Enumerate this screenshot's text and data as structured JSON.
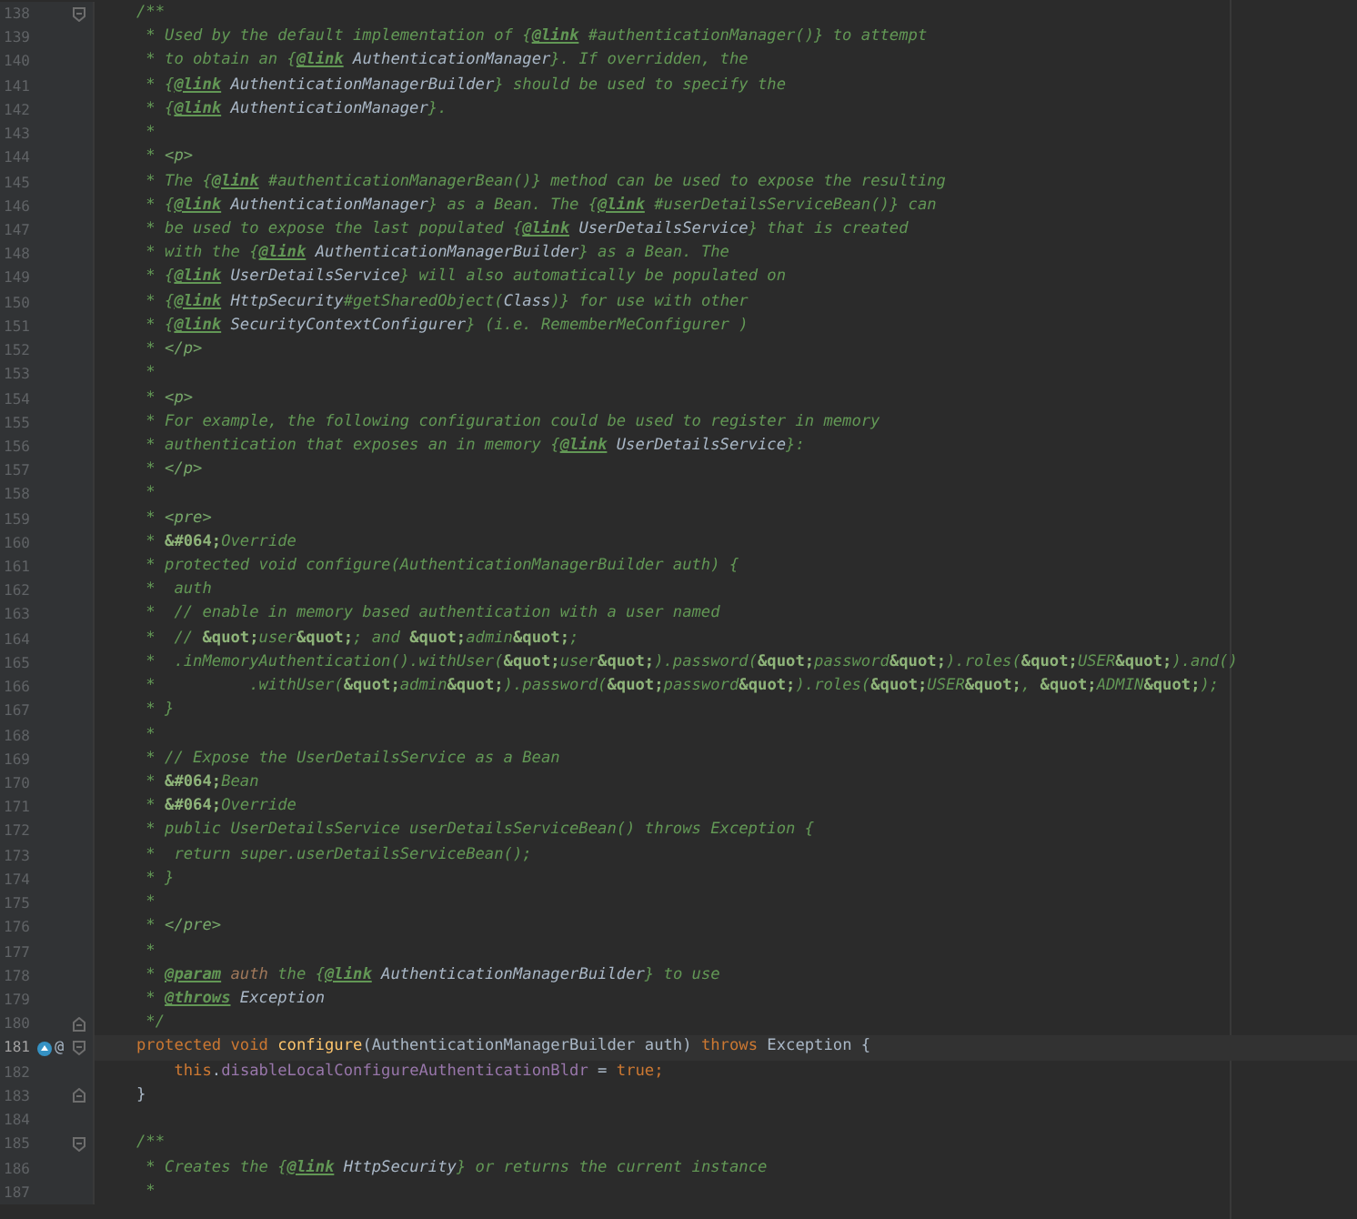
{
  "editor": {
    "lines": [
      {
        "number": "138",
        "current": false,
        "fold_start": true,
        "segments": [
          {
            "kind": "comment",
            "text": "/**"
          }
        ]
      },
      {
        "number": "139",
        "current": false,
        "segments": [
          {
            "kind": "comment",
            "text": " * Used by the default implementation of {"
          },
          {
            "kind": "tag",
            "text": "@link"
          },
          {
            "kind": "comment",
            "text": " #authenticationManager()} to attempt"
          }
        ]
      },
      {
        "number": "140",
        "current": false,
        "segments": [
          {
            "kind": "comment",
            "text": " * to obtain an {"
          },
          {
            "kind": "tag",
            "text": "@link"
          },
          {
            "kind": "ref",
            "text": " AuthenticationManager"
          },
          {
            "kind": "comment",
            "text": "}. If overridden, the"
          }
        ]
      },
      {
        "number": "141",
        "current": false,
        "segments": [
          {
            "kind": "comment",
            "text": " * {"
          },
          {
            "kind": "tag",
            "text": "@link"
          },
          {
            "kind": "ref",
            "text": " AuthenticationManagerBuilder"
          },
          {
            "kind": "comment",
            "text": "} should be used to specify the"
          }
        ]
      },
      {
        "number": "142",
        "current": false,
        "segments": [
          {
            "kind": "comment",
            "text": " * {"
          },
          {
            "kind": "tag",
            "text": "@link"
          },
          {
            "kind": "ref",
            "text": " AuthenticationManager"
          },
          {
            "kind": "comment",
            "text": "}."
          }
        ]
      },
      {
        "number": "143",
        "current": false,
        "segments": [
          {
            "kind": "comment",
            "text": " *"
          }
        ]
      },
      {
        "number": "144",
        "current": false,
        "segments": [
          {
            "kind": "comment",
            "text": " * "
          },
          {
            "kind": "html",
            "text": "<p>"
          }
        ]
      },
      {
        "number": "145",
        "current": false,
        "segments": [
          {
            "kind": "comment",
            "text": " * The {"
          },
          {
            "kind": "tag",
            "text": "@link"
          },
          {
            "kind": "comment",
            "text": " #authenticationManagerBean()} method can be used to expose the resulting"
          }
        ]
      },
      {
        "number": "146",
        "current": false,
        "segments": [
          {
            "kind": "comment",
            "text": " * {"
          },
          {
            "kind": "tag",
            "text": "@link"
          },
          {
            "kind": "ref",
            "text": " AuthenticationManager"
          },
          {
            "kind": "comment",
            "text": "} as a Bean. The {"
          },
          {
            "kind": "tag",
            "text": "@link"
          },
          {
            "kind": "comment",
            "text": " #userDetailsServiceBean()} can"
          }
        ]
      },
      {
        "number": "147",
        "current": false,
        "segments": [
          {
            "kind": "comment",
            "text": " * be used to expose the last populated {"
          },
          {
            "kind": "tag",
            "text": "@link"
          },
          {
            "kind": "ref",
            "text": " UserDetailsService"
          },
          {
            "kind": "comment",
            "text": "} that is created"
          }
        ]
      },
      {
        "number": "148",
        "current": false,
        "segments": [
          {
            "kind": "comment",
            "text": " * with the {"
          },
          {
            "kind": "tag",
            "text": "@link"
          },
          {
            "kind": "ref",
            "text": " AuthenticationManagerBuilder"
          },
          {
            "kind": "comment",
            "text": "} as a Bean. The"
          }
        ]
      },
      {
        "number": "149",
        "current": false,
        "segments": [
          {
            "kind": "comment",
            "text": " * {"
          },
          {
            "kind": "tag",
            "text": "@link"
          },
          {
            "kind": "ref",
            "text": " UserDetailsService"
          },
          {
            "kind": "comment",
            "text": "} will also automatically be populated on"
          }
        ]
      },
      {
        "number": "150",
        "current": false,
        "segments": [
          {
            "kind": "comment",
            "text": " * {"
          },
          {
            "kind": "tag",
            "text": "@link"
          },
          {
            "kind": "ref",
            "text": " HttpSecurity"
          },
          {
            "kind": "comment",
            "text": "#getSharedObject("
          },
          {
            "kind": "ref",
            "text": "Class"
          },
          {
            "kind": "comment",
            "text": ")} for use with other"
          }
        ]
      },
      {
        "number": "151",
        "current": false,
        "segments": [
          {
            "kind": "comment",
            "text": " * {"
          },
          {
            "kind": "tag",
            "text": "@link"
          },
          {
            "kind": "ref",
            "text": " SecurityContextConfigurer"
          },
          {
            "kind": "comment",
            "text": "} (i.e. RememberMeConfigurer )"
          }
        ]
      },
      {
        "number": "152",
        "current": false,
        "segments": [
          {
            "kind": "comment",
            "text": " * "
          },
          {
            "kind": "html",
            "text": "</p>"
          }
        ]
      },
      {
        "number": "153",
        "current": false,
        "segments": [
          {
            "kind": "comment",
            "text": " *"
          }
        ]
      },
      {
        "number": "154",
        "current": false,
        "segments": [
          {
            "kind": "comment",
            "text": " * "
          },
          {
            "kind": "html",
            "text": "<p>"
          }
        ]
      },
      {
        "number": "155",
        "current": false,
        "segments": [
          {
            "kind": "comment",
            "text": " * For example, the following configuration could be used to register in memory"
          }
        ]
      },
      {
        "number": "156",
        "current": false,
        "segments": [
          {
            "kind": "comment",
            "text": " * authentication that exposes an in memory {"
          },
          {
            "kind": "tag",
            "text": "@link"
          },
          {
            "kind": "ref",
            "text": " UserDetailsService"
          },
          {
            "kind": "comment",
            "text": "}:"
          }
        ]
      },
      {
        "number": "157",
        "current": false,
        "segments": [
          {
            "kind": "comment",
            "text": " * "
          },
          {
            "kind": "html",
            "text": "</p>"
          }
        ]
      },
      {
        "number": "158",
        "current": false,
        "segments": [
          {
            "kind": "comment",
            "text": " *"
          }
        ]
      },
      {
        "number": "159",
        "current": false,
        "segments": [
          {
            "kind": "comment",
            "text": " * "
          },
          {
            "kind": "html",
            "text": "<pre>"
          }
        ]
      },
      {
        "number": "160",
        "current": false,
        "segments": [
          {
            "kind": "comment",
            "text": " * "
          },
          {
            "kind": "entity",
            "text": "&#064;"
          },
          {
            "kind": "comment",
            "text": "Override"
          }
        ]
      },
      {
        "number": "161",
        "current": false,
        "segments": [
          {
            "kind": "comment",
            "text": " * protected void configure(AuthenticationManagerBuilder auth) {"
          }
        ]
      },
      {
        "number": "162",
        "current": false,
        "segments": [
          {
            "kind": "comment",
            "text": " *  auth"
          }
        ]
      },
      {
        "number": "163",
        "current": false,
        "segments": [
          {
            "kind": "comment",
            "text": " *  // enable in memory based authentication with a user named"
          }
        ]
      },
      {
        "number": "164",
        "current": false,
        "segments": [
          {
            "kind": "comment",
            "text": " *  // "
          },
          {
            "kind": "entity",
            "text": "&quot;"
          },
          {
            "kind": "comment",
            "text": "user"
          },
          {
            "kind": "entity",
            "text": "&quot;"
          },
          {
            "kind": "comment",
            "text": "; and "
          },
          {
            "kind": "entity",
            "text": "&quot;"
          },
          {
            "kind": "comment",
            "text": "admin"
          },
          {
            "kind": "entity",
            "text": "&quot;"
          },
          {
            "kind": "comment",
            "text": ";"
          }
        ]
      },
      {
        "number": "165",
        "current": false,
        "segments": [
          {
            "kind": "comment",
            "text": " *  .inMemoryAuthentication().withUser("
          },
          {
            "kind": "entity",
            "text": "&quot;"
          },
          {
            "kind": "comment",
            "text": "user"
          },
          {
            "kind": "entity",
            "text": "&quot;"
          },
          {
            "kind": "comment",
            "text": ").password("
          },
          {
            "kind": "entity",
            "text": "&quot;"
          },
          {
            "kind": "comment",
            "text": "password"
          },
          {
            "kind": "entity",
            "text": "&quot;"
          },
          {
            "kind": "comment",
            "text": ").roles("
          },
          {
            "kind": "entity",
            "text": "&quot;"
          },
          {
            "kind": "comment",
            "text": "USER"
          },
          {
            "kind": "entity",
            "text": "&quot;"
          },
          {
            "kind": "comment",
            "text": ").and()"
          }
        ]
      },
      {
        "number": "166",
        "current": false,
        "segments": [
          {
            "kind": "comment",
            "text": " *          .withUser("
          },
          {
            "kind": "entity",
            "text": "&quot;"
          },
          {
            "kind": "comment",
            "text": "admin"
          },
          {
            "kind": "entity",
            "text": "&quot;"
          },
          {
            "kind": "comment",
            "text": ").password("
          },
          {
            "kind": "entity",
            "text": "&quot;"
          },
          {
            "kind": "comment",
            "text": "password"
          },
          {
            "kind": "entity",
            "text": "&quot;"
          },
          {
            "kind": "comment",
            "text": ").roles("
          },
          {
            "kind": "entity",
            "text": "&quot;"
          },
          {
            "kind": "comment",
            "text": "USER"
          },
          {
            "kind": "entity",
            "text": "&quot;"
          },
          {
            "kind": "comment",
            "text": ", "
          },
          {
            "kind": "entity",
            "text": "&quot;"
          },
          {
            "kind": "comment",
            "text": "ADMIN"
          },
          {
            "kind": "entity",
            "text": "&quot;"
          },
          {
            "kind": "comment",
            "text": ");"
          }
        ]
      },
      {
        "number": "167",
        "current": false,
        "segments": [
          {
            "kind": "comment",
            "text": " * }"
          }
        ]
      },
      {
        "number": "168",
        "current": false,
        "segments": [
          {
            "kind": "comment",
            "text": " *"
          }
        ]
      },
      {
        "number": "169",
        "current": false,
        "segments": [
          {
            "kind": "comment",
            "text": " * // Expose the UserDetailsService as a Bean"
          }
        ]
      },
      {
        "number": "170",
        "current": false,
        "segments": [
          {
            "kind": "comment",
            "text": " * "
          },
          {
            "kind": "entity",
            "text": "&#064;"
          },
          {
            "kind": "comment",
            "text": "Bean"
          }
        ]
      },
      {
        "number": "171",
        "current": false,
        "segments": [
          {
            "kind": "comment",
            "text": " * "
          },
          {
            "kind": "entity",
            "text": "&#064;"
          },
          {
            "kind": "comment",
            "text": "Override"
          }
        ]
      },
      {
        "number": "172",
        "current": false,
        "segments": [
          {
            "kind": "comment",
            "text": " * public UserDetailsService userDetailsServiceBean() throws Exception {"
          }
        ]
      },
      {
        "number": "173",
        "current": false,
        "segments": [
          {
            "kind": "comment",
            "text": " *  return super.userDetailsServiceBean();"
          }
        ]
      },
      {
        "number": "174",
        "current": false,
        "segments": [
          {
            "kind": "comment",
            "text": " * }"
          }
        ]
      },
      {
        "number": "175",
        "current": false,
        "segments": [
          {
            "kind": "comment",
            "text": " *"
          }
        ]
      },
      {
        "number": "176",
        "current": false,
        "segments": [
          {
            "kind": "comment",
            "text": " * "
          },
          {
            "kind": "html",
            "text": "</pre>"
          }
        ]
      },
      {
        "number": "177",
        "current": false,
        "segments": [
          {
            "kind": "comment",
            "text": " *"
          }
        ]
      },
      {
        "number": "178",
        "current": false,
        "segments": [
          {
            "kind": "comment",
            "text": " * "
          },
          {
            "kind": "tag",
            "text": "@param"
          },
          {
            "kind": "param",
            "text": " auth"
          },
          {
            "kind": "comment",
            "text": " the {"
          },
          {
            "kind": "tag",
            "text": "@link"
          },
          {
            "kind": "ref",
            "text": " AuthenticationManagerBuilder"
          },
          {
            "kind": "comment",
            "text": "} to use"
          }
        ]
      },
      {
        "number": "179",
        "current": false,
        "segments": [
          {
            "kind": "comment",
            "text": " * "
          },
          {
            "kind": "tag",
            "text": "@throws"
          },
          {
            "kind": "ref",
            "text": " Exception"
          }
        ]
      },
      {
        "number": "180",
        "current": false,
        "fold_end": true,
        "segments": [
          {
            "kind": "comment",
            "text": " */"
          }
        ]
      },
      {
        "number": "181",
        "current": true,
        "fold_start": true,
        "overridden": true,
        "gutter_text": "@",
        "segments": [
          {
            "kind": "keyword",
            "text": "protected void "
          },
          {
            "kind": "method",
            "text": "configure"
          },
          {
            "kind": "plain",
            "text": "(AuthenticationManagerBuilder auth) "
          },
          {
            "kind": "keyword",
            "text": "throws "
          },
          {
            "kind": "plain",
            "text": "Exception {"
          }
        ]
      },
      {
        "number": "182",
        "current": false,
        "segments": [
          {
            "kind": "keyword",
            "text": "    this"
          },
          {
            "kind": "plain",
            "text": "."
          },
          {
            "kind": "field",
            "text": "disableLocalConfigureAuthenticationBldr"
          },
          {
            "kind": "plain",
            "text": " = "
          },
          {
            "kind": "keyword",
            "text": "true;"
          }
        ]
      },
      {
        "number": "183",
        "current": false,
        "fold_end": true,
        "segments": [
          {
            "kind": "plain",
            "text": "}"
          }
        ]
      },
      {
        "number": "184",
        "current": false
      },
      {
        "number": "185",
        "current": false,
        "fold_start": true,
        "segments": [
          {
            "kind": "comment",
            "text": "/**"
          }
        ]
      },
      {
        "number": "186",
        "current": false,
        "segments": [
          {
            "kind": "comment",
            "text": " * Creates the {"
          },
          {
            "kind": "tag",
            "text": "@link"
          },
          {
            "kind": "ref",
            "text": " HttpSecurity"
          },
          {
            "kind": "comment",
            "text": "} or returns the current instance"
          }
        ]
      },
      {
        "number": "187",
        "current": false,
        "segments": [
          {
            "kind": "comment",
            "text": " *"
          }
        ]
      }
    ]
  }
}
